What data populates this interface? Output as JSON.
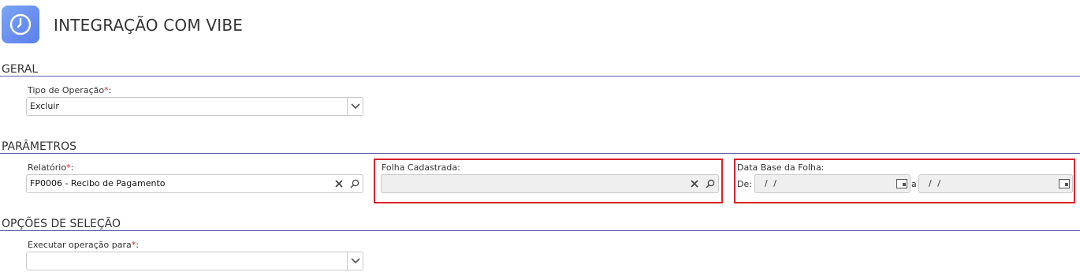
{
  "header": {
    "title": "INTEGRAÇÃO COM VIBE",
    "icon": "clock-icon"
  },
  "sections": {
    "geral": {
      "title": "GERAL",
      "tipo_operacao": {
        "label": "Tipo de Operação",
        "required_mark": "*",
        "suffix": ":",
        "value": "Excluir"
      }
    },
    "parametros": {
      "title": "PARÂMETROS",
      "relatorio": {
        "label": "Relatório",
        "required_mark": "*",
        "suffix": ":",
        "value": "FP0006 - Recibo de Pagamento"
      },
      "folha_cadastrada": {
        "label": "Folha Cadastrada:",
        "value": ""
      },
      "data_base_folha": {
        "label": "Data Base da Folha:",
        "from_label": "De:",
        "from_value": "/ /",
        "to_label": "a",
        "to_value": "/ /"
      }
    },
    "opcoes": {
      "title": "OPÇÕES DE SELEÇÃO",
      "executar_para": {
        "label": "Executar operação para",
        "required_mark": "*",
        "suffix": ":",
        "value": ""
      }
    }
  },
  "colors": {
    "accent_rule": "#5b5ba8",
    "required": "#d9232d",
    "highlight": "#d9232d",
    "icon_bg": "#6a8ff0"
  }
}
